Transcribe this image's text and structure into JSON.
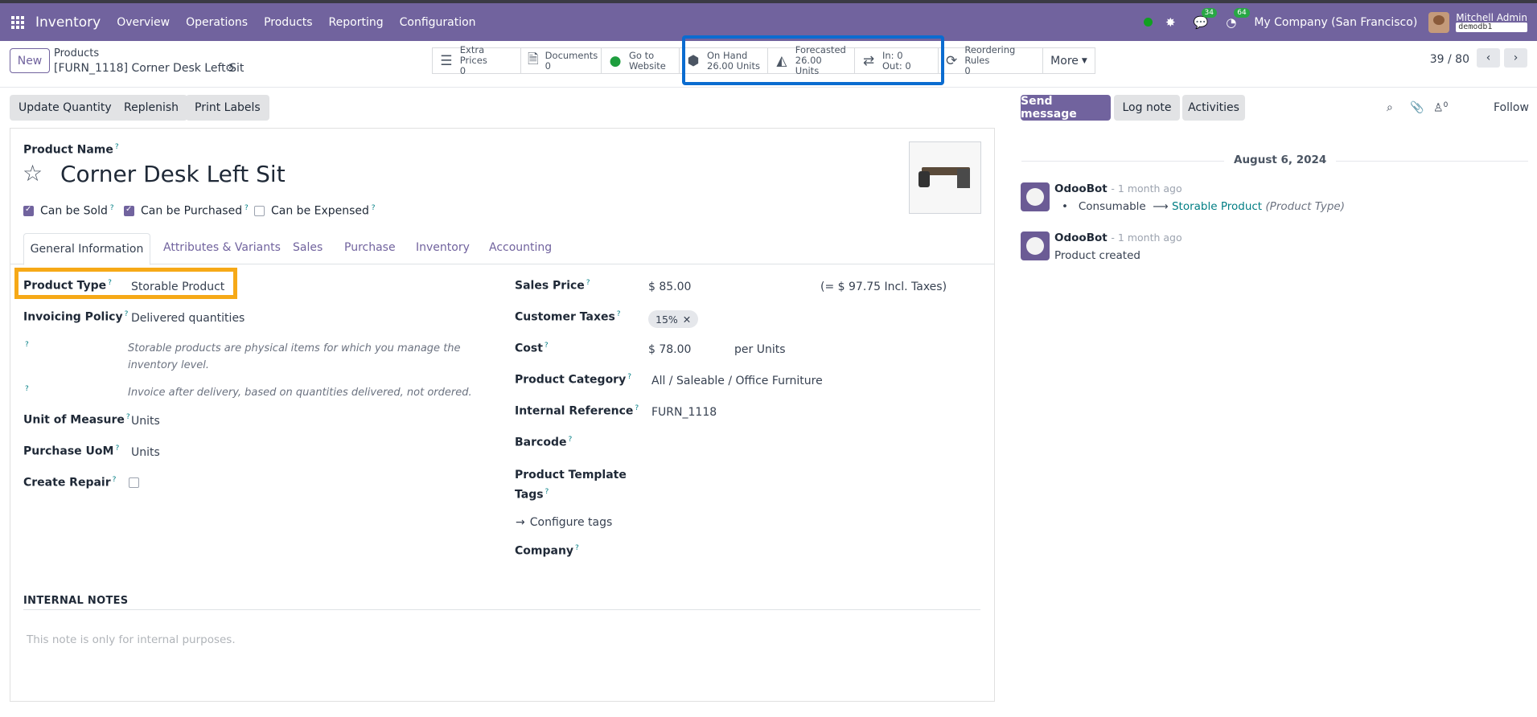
{
  "topbar": {
    "app_name": "Inventory",
    "menu": [
      "Overview",
      "Operations",
      "Products",
      "Reporting",
      "Configuration"
    ],
    "chat_badge": "34",
    "activity_badge": "64",
    "company": "My Company (San Francisco)",
    "user_name": "Mitchell Admin",
    "db_name": "demodb1"
  },
  "control": {
    "new_label": "New",
    "breadcrumb_parent": "Products",
    "breadcrumb_current": "[FURN_1118] Corner Desk Left Sit",
    "pager": "39 / 80",
    "smart_buttons": {
      "extra_prices": {
        "label": "Extra Prices",
        "value": "0"
      },
      "documents": {
        "label": "Documents",
        "value": "0"
      },
      "website": {
        "label": "Go to",
        "value": "Website"
      },
      "on_hand": {
        "label": "On Hand",
        "value": "26.00 Units"
      },
      "forecasted": {
        "label": "Forecasted",
        "value": "26.00 Units"
      },
      "in_out": {
        "label": "In: 0",
        "value": "Out: 0"
      },
      "reordering": {
        "label": "Reordering Rules",
        "value": "0"
      },
      "more": "More"
    }
  },
  "actions": {
    "update_quantity": "Update Quantity",
    "replenish": "Replenish",
    "print_labels": "Print Labels"
  },
  "chatter": {
    "send_message": "Send message",
    "log_note": "Log note",
    "activities": "Activities",
    "followers_count": "0",
    "follow": "Follow",
    "date": "August 6, 2024",
    "messages": [
      {
        "author": "OdooBot",
        "time": "- 1 month ago",
        "old": "Consumable",
        "new": "Storable Product",
        "field": "(Product Type)"
      },
      {
        "author": "OdooBot",
        "time": "- 1 month ago",
        "body": "Product created"
      }
    ]
  },
  "form": {
    "name_label": "Product Name",
    "name": "Corner Desk Left Sit",
    "can_be_sold": "Can be Sold",
    "can_be_purchased": "Can be Purchased",
    "can_be_expensed": "Can be Expensed",
    "tabs": [
      "General Information",
      "Attributes & Variants",
      "Sales",
      "Purchase",
      "Inventory",
      "Accounting"
    ],
    "left": {
      "product_type_label": "Product Type",
      "product_type": "Storable Product",
      "invoicing_policy_label": "Invoicing Policy",
      "invoicing_policy": "Delivered quantities",
      "help_storable": "Storable products are physical items for which you manage the inventory level.",
      "help_invoice": "Invoice after delivery, based on quantities delivered, not ordered.",
      "uom_label": "Unit of Measure",
      "uom": "Units",
      "purchase_uom_label": "Purchase UoM",
      "purchase_uom": "Units",
      "create_repair_label": "Create Repair"
    },
    "right": {
      "sales_price_label": "Sales Price",
      "sales_price": "$ 85.00",
      "incl_taxes": "(= $ 97.75 Incl. Taxes)",
      "customer_taxes_label": "Customer Taxes",
      "customer_tax_tag": "15%",
      "cost_label": "Cost",
      "cost": "$ 78.00",
      "cost_unit": "per Units",
      "category_label": "Product Category",
      "category": "All / Saleable / Office Furniture",
      "internal_ref_label": "Internal Reference",
      "internal_ref": "FURN_1118",
      "barcode_label": "Barcode",
      "template_tags_label_1": "Product Template",
      "template_tags_label_2": "Tags",
      "configure_tags": "Configure tags",
      "company_label": "Company"
    },
    "notes_title": "INTERNAL NOTES",
    "notes_placeholder": "This note is only for internal purposes."
  },
  "colors": {
    "brand": "#71639e",
    "highlight_blue": "#0b6cd0",
    "highlight_orange": "#f6a917"
  }
}
